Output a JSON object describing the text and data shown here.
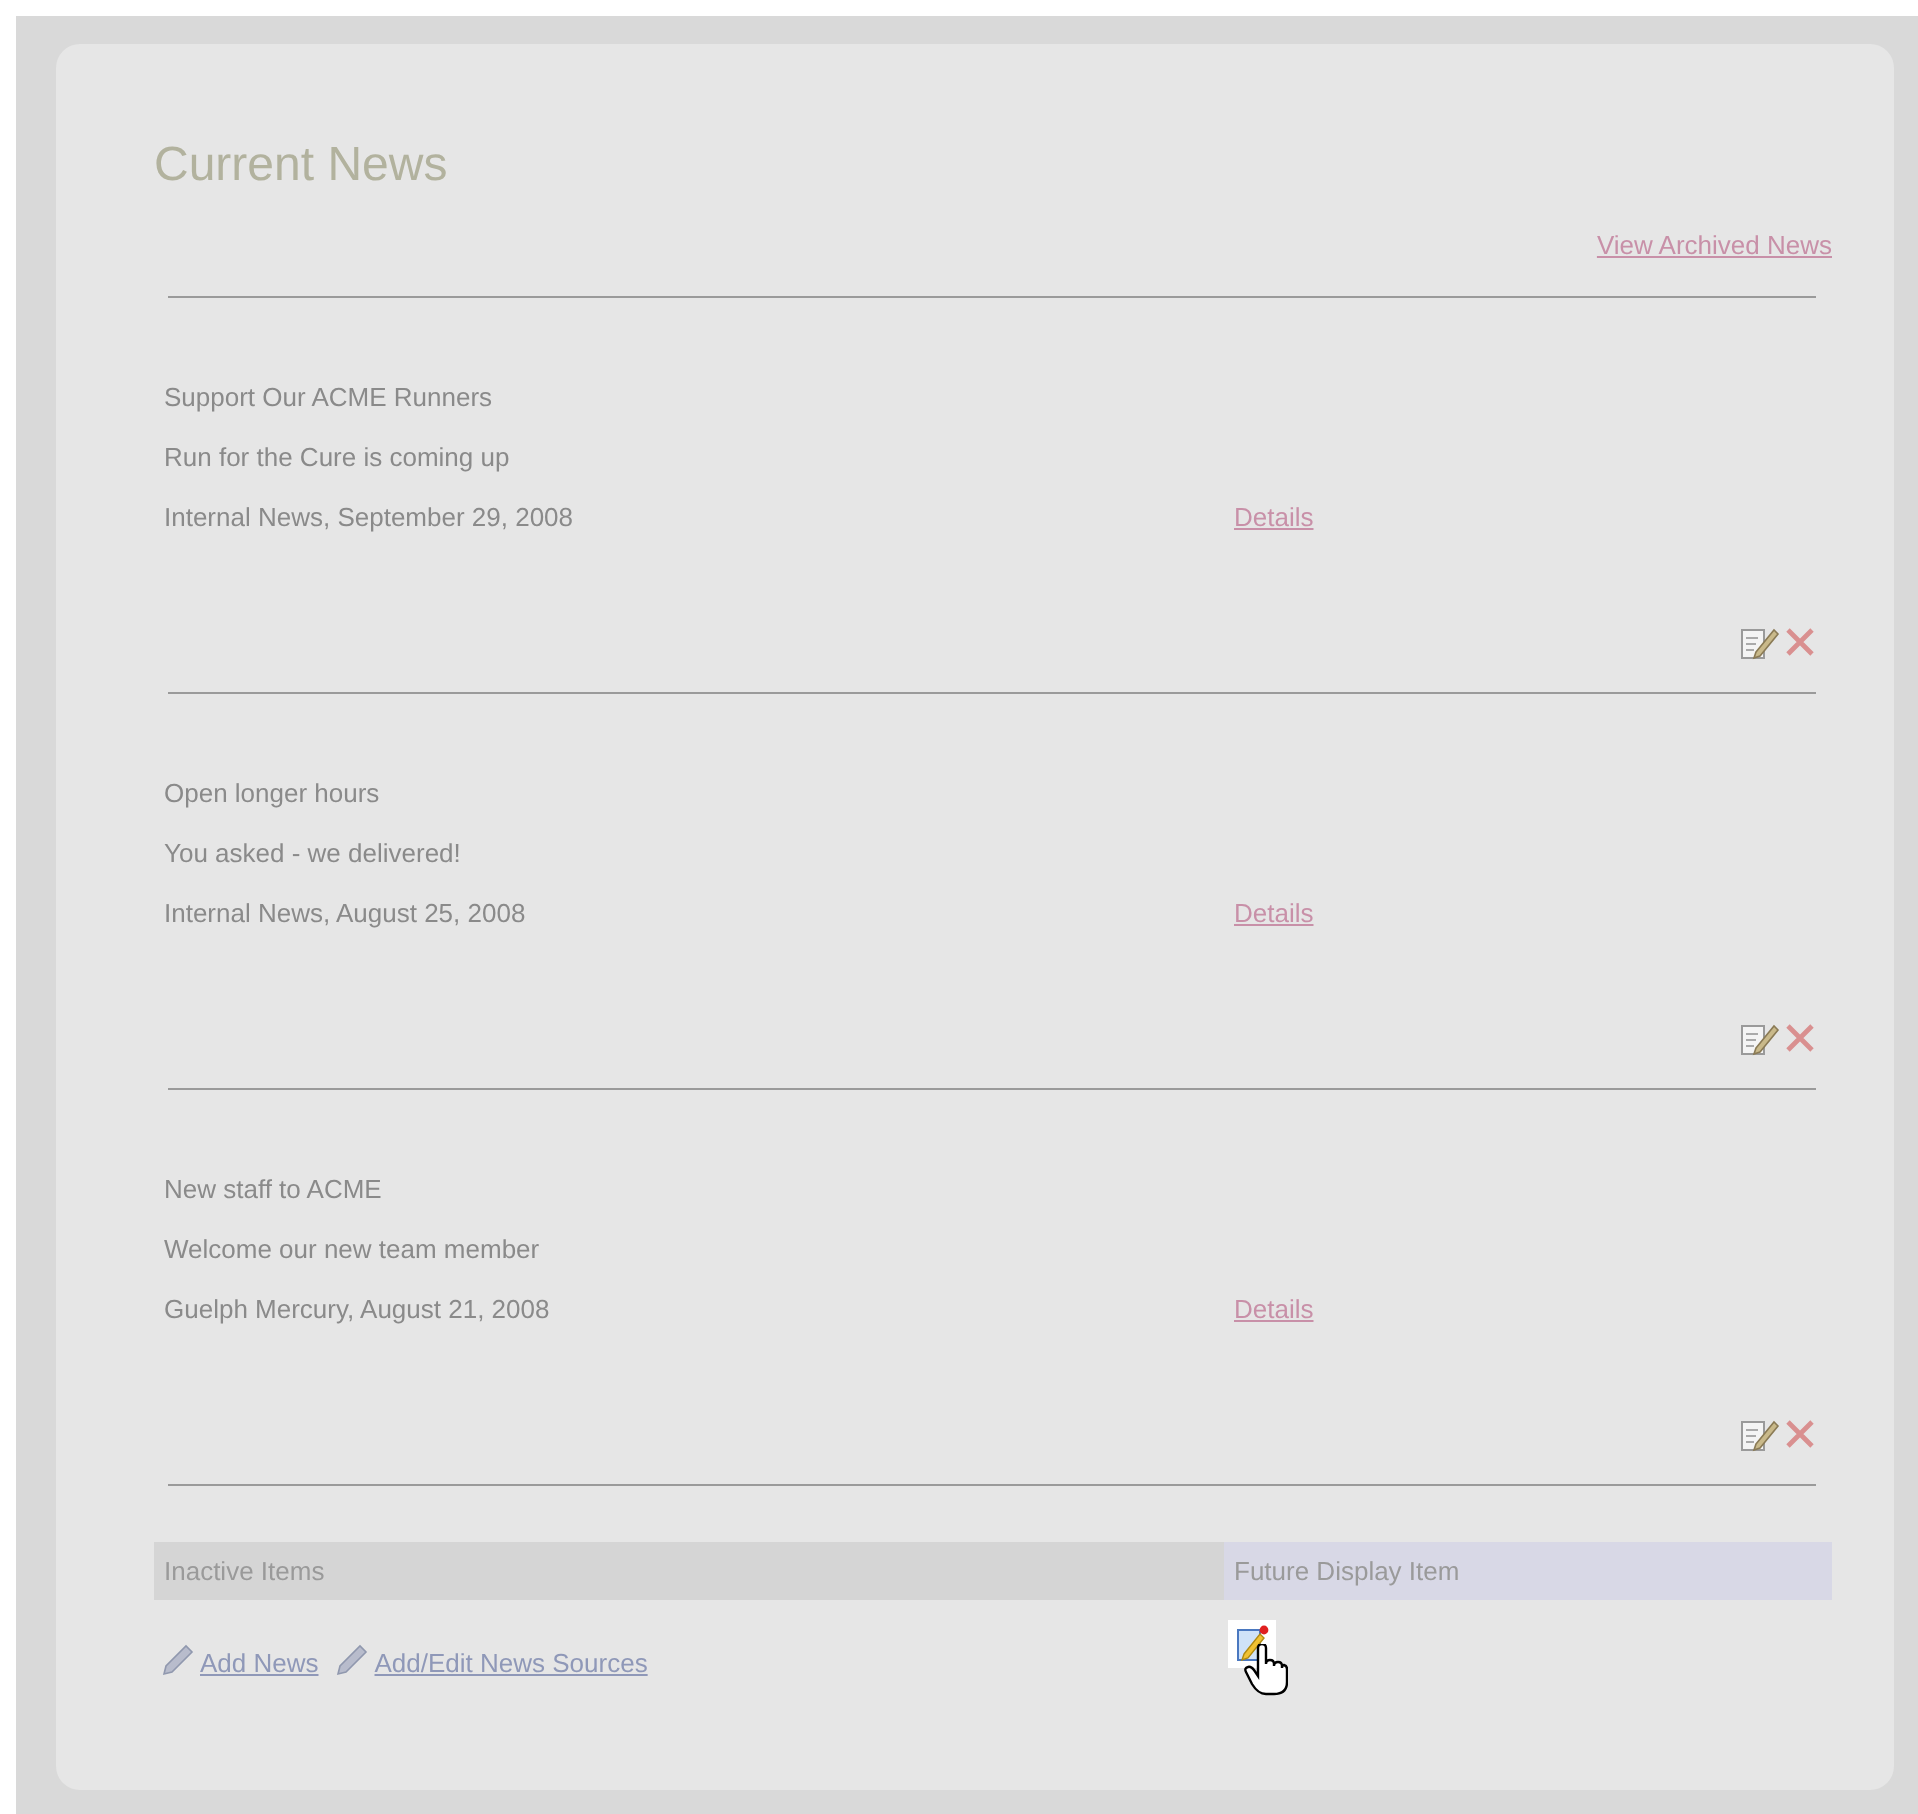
{
  "title": "Current News",
  "archive_link": "View Archived News",
  "news": [
    {
      "headline": "Support Our ACME Runners",
      "summary": "Run for the Cure is coming up",
      "source_date": "Internal News, September 29, 2008",
      "details_link": "Details"
    },
    {
      "headline": "Open longer hours",
      "summary": "You asked - we delivered!",
      "source_date": "Internal News, August 25, 2008",
      "details_link": "Details"
    },
    {
      "headline": "New staff to ACME",
      "summary": "Welcome our new team member",
      "source_date": "Guelph Mercury, August 21, 2008",
      "details_link": "Details"
    }
  ],
  "footer_table": {
    "columns": [
      "Inactive Items",
      "Future Display Item"
    ],
    "links": [
      "Add News",
      "Add/Edit News Sources"
    ]
  }
}
